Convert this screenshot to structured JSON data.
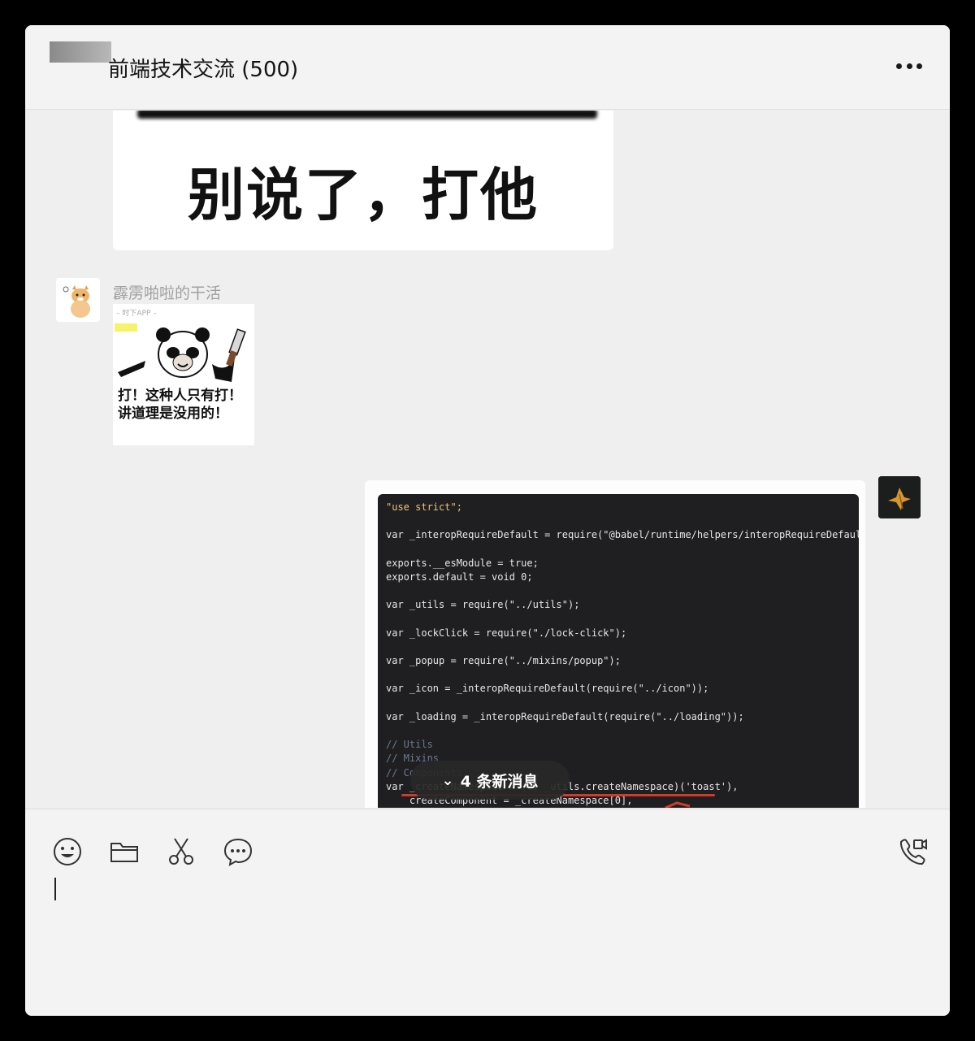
{
  "header": {
    "title": "前端技术交流 (500)",
    "more_icon": "more-horizontal-icon"
  },
  "messages": {
    "meme1_text": "别说了，打他",
    "sender_name": "霹雳啪啦的干活",
    "meme2": {
      "watermark": "– 时下APP –",
      "caption_line1": "打！这种人只有打！",
      "caption_line2": "讲道理是没用的！"
    },
    "code_lines": [
      "\"use strict\";",
      "",
      "var _interopRequireDefault = require(\"@babel/runtime/helpers/interopRequireDefault\");",
      "",
      "exports.__esModule = true;",
      "exports.default = void 0;",
      "",
      "var _utils = require(\"../utils\");",
      "",
      "var _lockClick = require(\"./lock-click\");",
      "",
      "var _popup = require(\"../mixins/popup\");",
      "",
      "var _icon = _interopRequireDefault(require(\"../icon\"));",
      "",
      "var _loading = _interopRequireDefault(require(\"../loading\"));",
      "",
      "// Utils",
      "// Mixins",
      "// Components",
      "var _createNamespace = (0, _utils.createNamespace)('toast'),",
      "    createComponent = _createNamespace[0],"
    ]
  },
  "new_messages_badge": {
    "label": "4 条新消息",
    "icon": "double-chevron-down-icon"
  },
  "toolbar": {
    "icons": [
      "emoji-icon",
      "folder-icon",
      "scissors-icon",
      "chat-bubble-icon"
    ],
    "call_icon": "phone-video-icon"
  },
  "colors": {
    "window_bg": "#efefef",
    "header_bg": "#f3f3f3",
    "code_bg": "#1f1f22",
    "accent_red": "#d23a2a"
  }
}
